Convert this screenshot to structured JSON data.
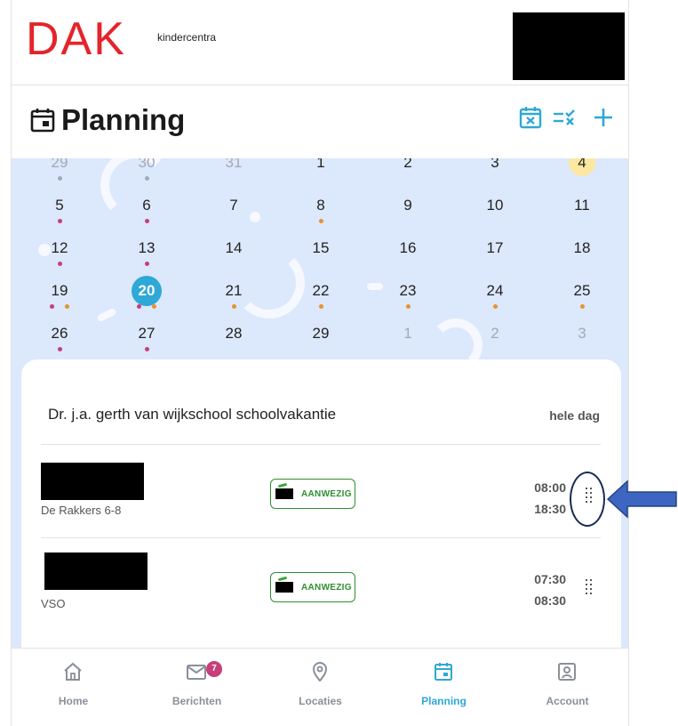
{
  "header": {
    "logo_text": "DAK",
    "logo_sub": "kindercentra"
  },
  "page": {
    "title": "Planning",
    "title_icon": "calendar-icon",
    "actions": [
      {
        "name": "calendar-cancel-icon"
      },
      {
        "name": "list-check-icon"
      },
      {
        "name": "plus-icon"
      }
    ]
  },
  "calendar": {
    "colors": {
      "pink": "#c73e7a",
      "orange": "#e8922f",
      "gray": "#a4a9b5",
      "selected": "#2ea8d6",
      "highlight": "#fbe7a1"
    },
    "weeks": [
      [
        {
          "day": "29",
          "muted": true,
          "dots": [
            "gray"
          ]
        },
        {
          "day": "30",
          "muted": true,
          "dots": [
            "gray"
          ]
        },
        {
          "day": "31",
          "muted": true,
          "dots": []
        },
        {
          "day": "1",
          "dots": []
        },
        {
          "day": "2",
          "dots": []
        },
        {
          "day": "3",
          "dots": []
        },
        {
          "day": "4",
          "highlight": true,
          "dots": []
        }
      ],
      [
        {
          "day": "5",
          "dots": [
            "pink"
          ]
        },
        {
          "day": "6",
          "dots": [
            "pink"
          ]
        },
        {
          "day": "7",
          "dots": []
        },
        {
          "day": "8",
          "dots": [
            "orange"
          ]
        },
        {
          "day": "9",
          "dots": []
        },
        {
          "day": "10",
          "dots": []
        },
        {
          "day": "11",
          "dots": []
        }
      ],
      [
        {
          "day": "12",
          "dots": [
            "pink"
          ]
        },
        {
          "day": "13",
          "dots": [
            "pink"
          ]
        },
        {
          "day": "14",
          "dots": []
        },
        {
          "day": "15",
          "dots": []
        },
        {
          "day": "16",
          "dots": []
        },
        {
          "day": "17",
          "dots": []
        },
        {
          "day": "18",
          "dots": []
        }
      ],
      [
        {
          "day": "19",
          "dots": [
            "pink",
            "orange"
          ]
        },
        {
          "day": "20",
          "selected": true,
          "dots": [
            "pink",
            "orange"
          ]
        },
        {
          "day": "21",
          "dots": [
            "orange"
          ]
        },
        {
          "day": "22",
          "dots": [
            "orange"
          ]
        },
        {
          "day": "23",
          "dots": [
            "orange"
          ]
        },
        {
          "day": "24",
          "dots": [
            "orange"
          ]
        },
        {
          "day": "25",
          "dots": [
            "orange"
          ]
        }
      ],
      [
        {
          "day": "26",
          "dots": [
            "pink"
          ]
        },
        {
          "day": "27",
          "dots": [
            "pink"
          ]
        },
        {
          "day": "28",
          "dots": []
        },
        {
          "day": "29",
          "dots": []
        },
        {
          "day": "1",
          "muted": true,
          "dots": []
        },
        {
          "day": "2",
          "muted": true,
          "dots": []
        },
        {
          "day": "3",
          "muted": true,
          "dots": []
        }
      ]
    ]
  },
  "event": {
    "name": "Dr. j.a. gerth van wijkschool schoolvakantie",
    "duration": "hele dag"
  },
  "entries": [
    {
      "location": "De Rakkers 6-8",
      "status": "AANWEZIG",
      "start": "08:00",
      "end": "18:30"
    },
    {
      "location": "VSO",
      "status": "AANWEZIG",
      "start": "07:30",
      "end": "08:30"
    }
  ],
  "nav": [
    {
      "label": "Home",
      "icon": "home-icon"
    },
    {
      "label": "Berichten",
      "icon": "mail-icon",
      "badge": "7"
    },
    {
      "label": "Locaties",
      "icon": "location-pin-icon"
    },
    {
      "label": "Planning",
      "icon": "calendar-icon",
      "active": true
    },
    {
      "label": "Account",
      "icon": "account-icon"
    }
  ],
  "annotation_color": "#3d66c2"
}
